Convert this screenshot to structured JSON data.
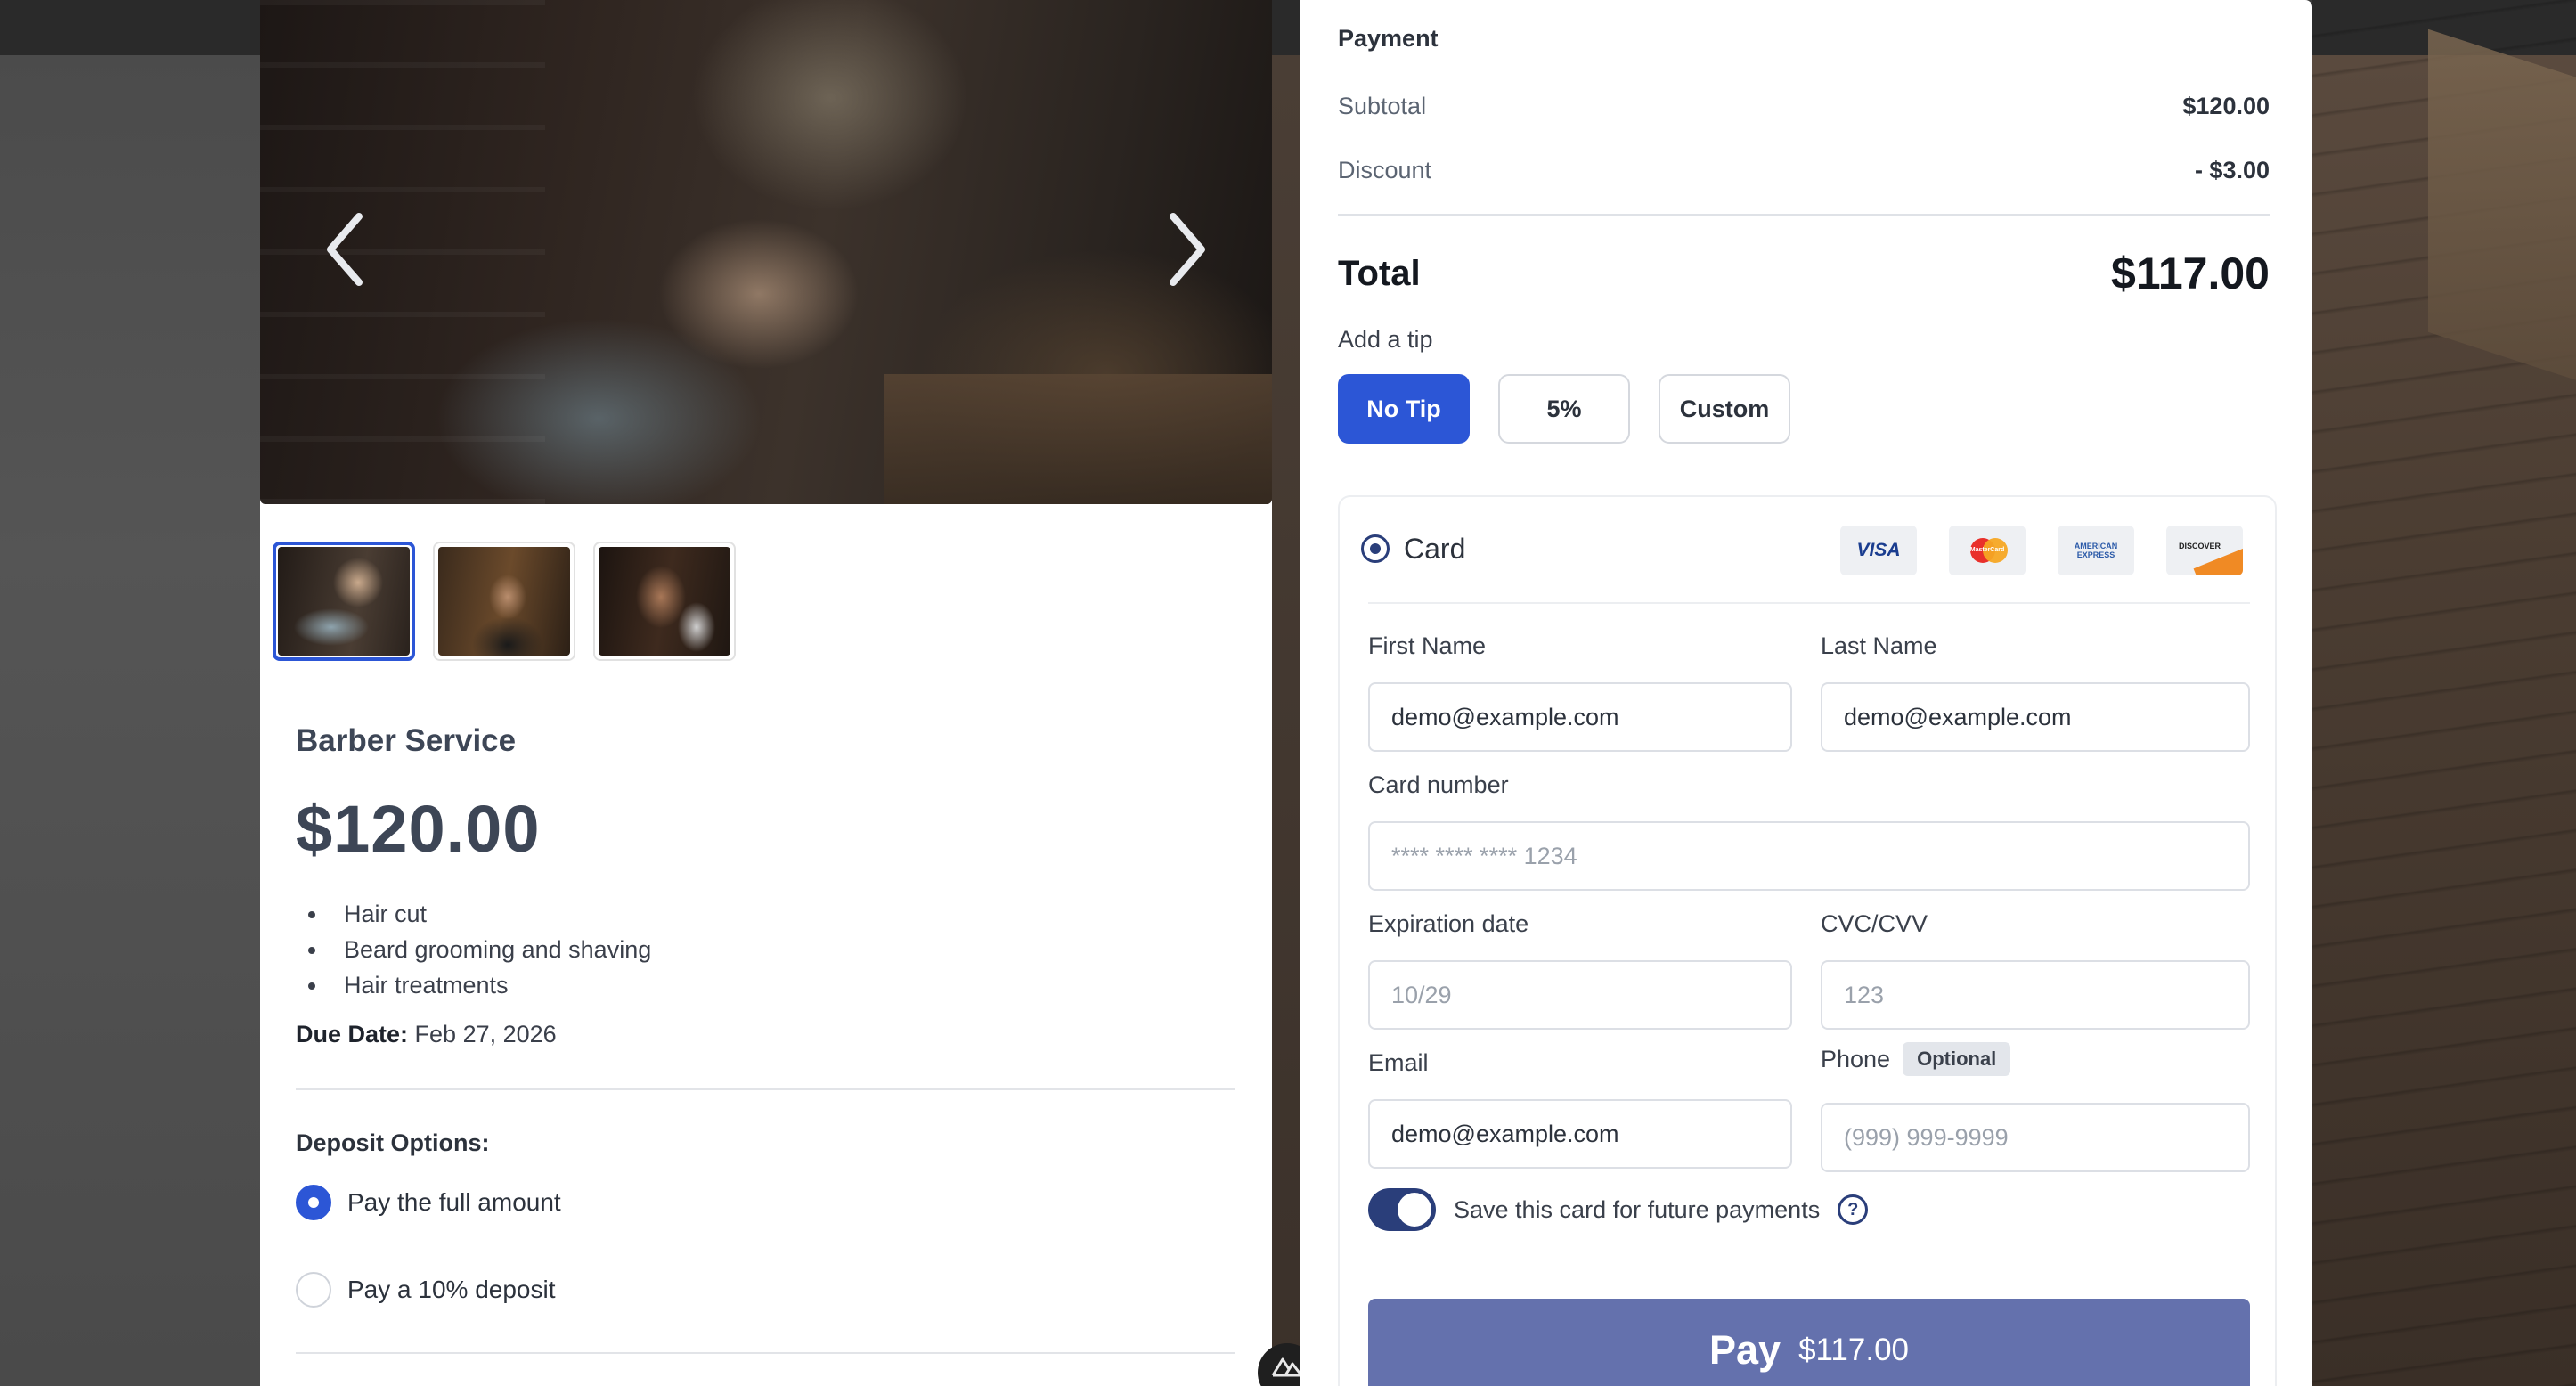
{
  "service": {
    "title": "Barber Service",
    "price": "$120.00",
    "features": [
      "Hair cut",
      "Beard grooming and shaving",
      "Hair treatments"
    ],
    "due_label": "Due Date:",
    "due_value": "Feb 27, 2026"
  },
  "gallery": {
    "active_index": 0,
    "thumbnails": 3
  },
  "deposit": {
    "title": "Deposit Options:",
    "options": [
      {
        "label": "Pay the full amount",
        "selected": true
      },
      {
        "label": "Pay a 10% deposit",
        "selected": false
      }
    ]
  },
  "payment": {
    "heading": "Payment",
    "subtotal_label": "Subtotal",
    "subtotal_value": "$120.00",
    "discount_label": "Discount",
    "discount_value": "- $3.00",
    "total_label": "Total",
    "total_value": "$117.00",
    "tip_label": "Add a tip",
    "tips": [
      {
        "label": "No Tip",
        "active": true
      },
      {
        "label": "5%",
        "active": false
      },
      {
        "label": "Custom",
        "active": false
      }
    ]
  },
  "card": {
    "title": "Card",
    "brands": {
      "visa": "VISA",
      "mastercard": "MasterCard",
      "amex_line1": "AMERICAN",
      "amex_line2": "EXPRESS",
      "discover": "DISCOVER"
    },
    "first_name_label": "First Name",
    "first_name_value": "demo@example.com",
    "last_name_label": "Last Name",
    "last_name_value": "demo@example.com",
    "card_number_label": "Card number",
    "card_number_placeholder": "**** **** **** 1234",
    "expiration_label": "Expiration date",
    "expiration_placeholder": "10/29",
    "cvc_label": "CVC/CVV",
    "cvc_placeholder": "123",
    "email_label": "Email",
    "email_value": "demo@example.com",
    "phone_label": "Phone",
    "phone_badge": "Optional",
    "phone_placeholder": "(999) 999-9999",
    "save_card_label": "Save this card for future payments",
    "save_card_on": true,
    "help_icon": "?",
    "pay_label": "Pay",
    "pay_amount": "$117.00"
  },
  "colors": {
    "accent": "#2c56d6",
    "pay_button": "#6471ad",
    "toggle": "#2a3e7a"
  }
}
